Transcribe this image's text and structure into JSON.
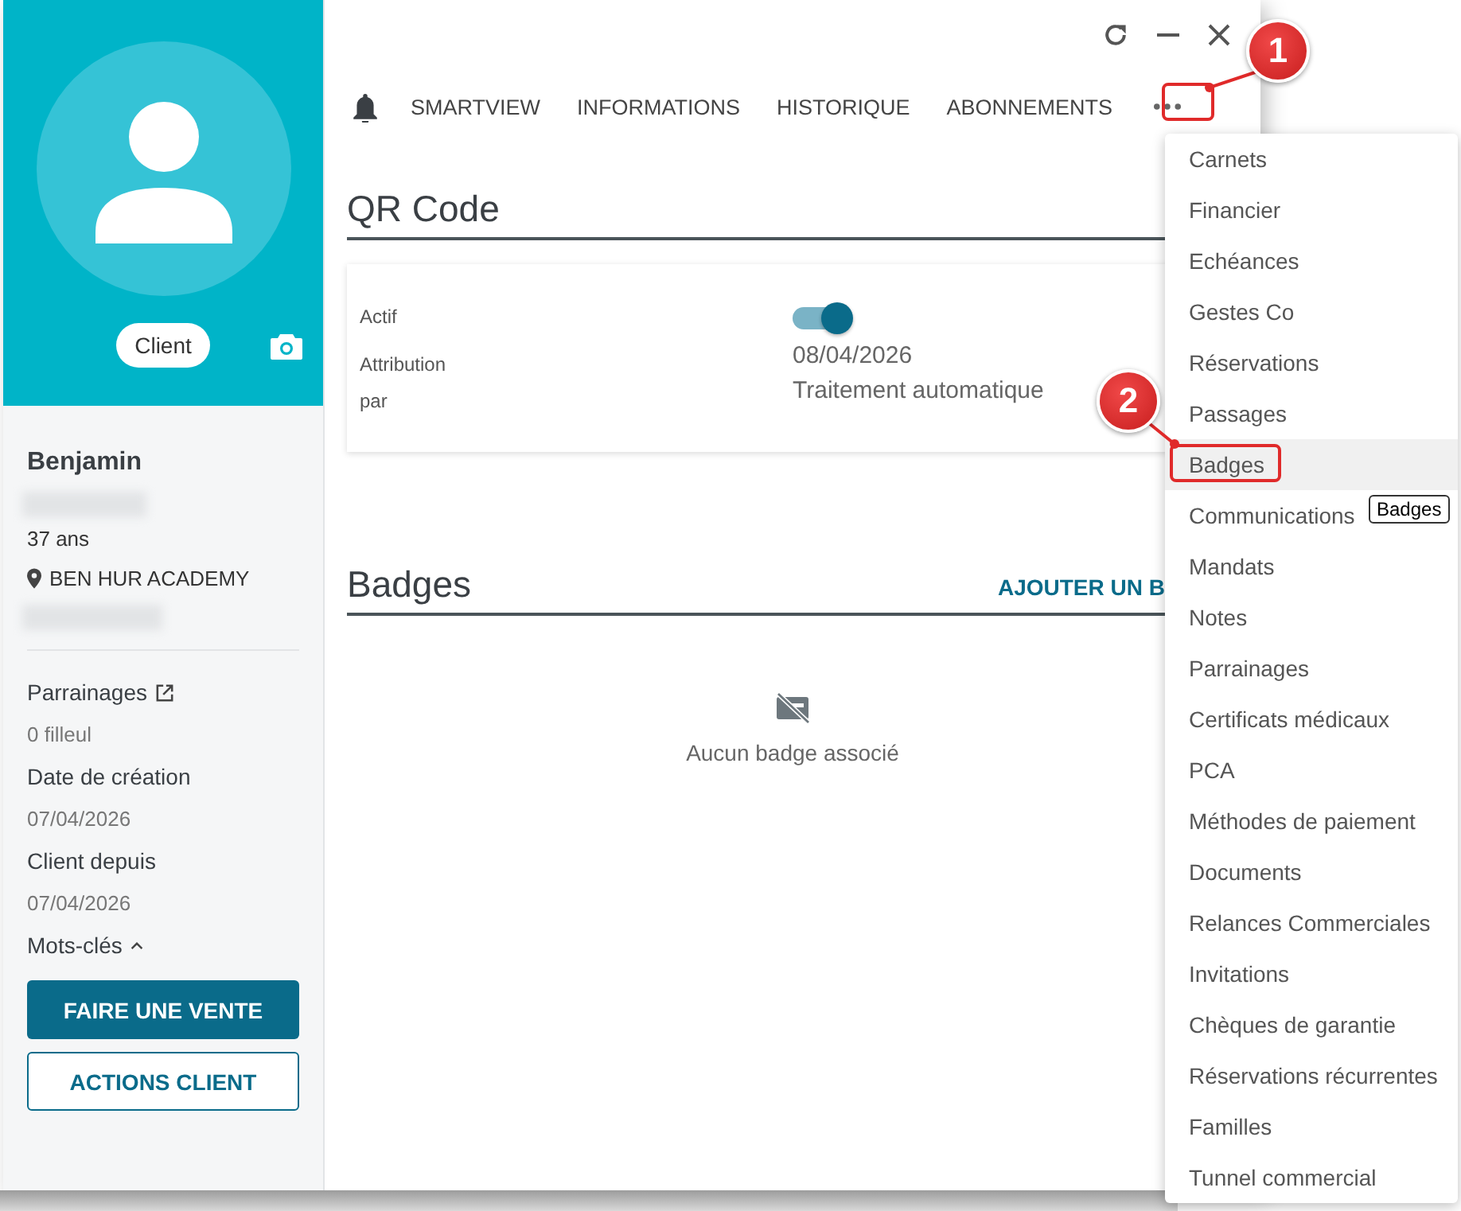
{
  "sidebar": {
    "avatar_tag": "Client",
    "name": "Benjamin",
    "age": "37 ans",
    "company": "BEN HUR ACADEMY",
    "fields": [
      {
        "label": "Parrainages",
        "value": "0 filleul",
        "link": true
      },
      {
        "label": "Date de création",
        "value": "07/04/2026",
        "link": false
      },
      {
        "label": "Client depuis",
        "value": "07/04/2026",
        "link": false
      }
    ],
    "keywords": {
      "label": "Mots-clés",
      "expanded": true
    },
    "buttons": [
      {
        "label": "FAIRE UNE VENTE",
        "kind": "primary"
      },
      {
        "label": "ACTIONS CLIENT",
        "kind": "outline"
      }
    ]
  },
  "tabs": [
    {
      "label": "SMARTVIEW"
    },
    {
      "label": "INFORMATIONS"
    },
    {
      "label": "HISTORIQUE"
    },
    {
      "label": "ABONNEMENTS"
    }
  ],
  "qr_section": {
    "title": "QR Code",
    "active_label": "Actif",
    "active_on": true,
    "attribution_label": "Attribution",
    "attribution_date": "08/04/2026",
    "by_label": "par",
    "by_value": "Traitement automatique"
  },
  "badges_section": {
    "title": "Badges",
    "add_action": "AJOUTER UN B",
    "empty_text": "Aucun badge associé"
  },
  "menu": [
    {
      "label": "Carnets",
      "highlighted": false
    },
    {
      "label": "Financier",
      "highlighted": false
    },
    {
      "label": "Echéances",
      "highlighted": false
    },
    {
      "label": "Gestes Co",
      "highlighted": false
    },
    {
      "label": "Réservations",
      "highlighted": false
    },
    {
      "label": "Passages",
      "highlighted": false
    },
    {
      "label": "Badges",
      "highlighted": true
    },
    {
      "label": "Communications",
      "highlighted": false
    },
    {
      "label": "Mandats",
      "highlighted": false
    },
    {
      "label": "Notes",
      "highlighted": false
    },
    {
      "label": "Parrainages",
      "highlighted": false
    },
    {
      "label": "Certificats médicaux",
      "highlighted": false
    },
    {
      "label": "PCA",
      "highlighted": false
    },
    {
      "label": "Méthodes de paiement",
      "highlighted": false
    },
    {
      "label": "Documents",
      "highlighted": false
    },
    {
      "label": "Relances Commerciales",
      "highlighted": false
    },
    {
      "label": "Invitations",
      "highlighted": false
    },
    {
      "label": "Chèques de garantie",
      "highlighted": false
    },
    {
      "label": "Réservations récurrentes",
      "highlighted": false
    },
    {
      "label": "Familles",
      "highlighted": false
    },
    {
      "label": "Tunnel commercial",
      "highlighted": false
    }
  ],
  "tooltip": "Badges",
  "callouts": [
    {
      "number": "1"
    },
    {
      "number": "2"
    }
  ]
}
